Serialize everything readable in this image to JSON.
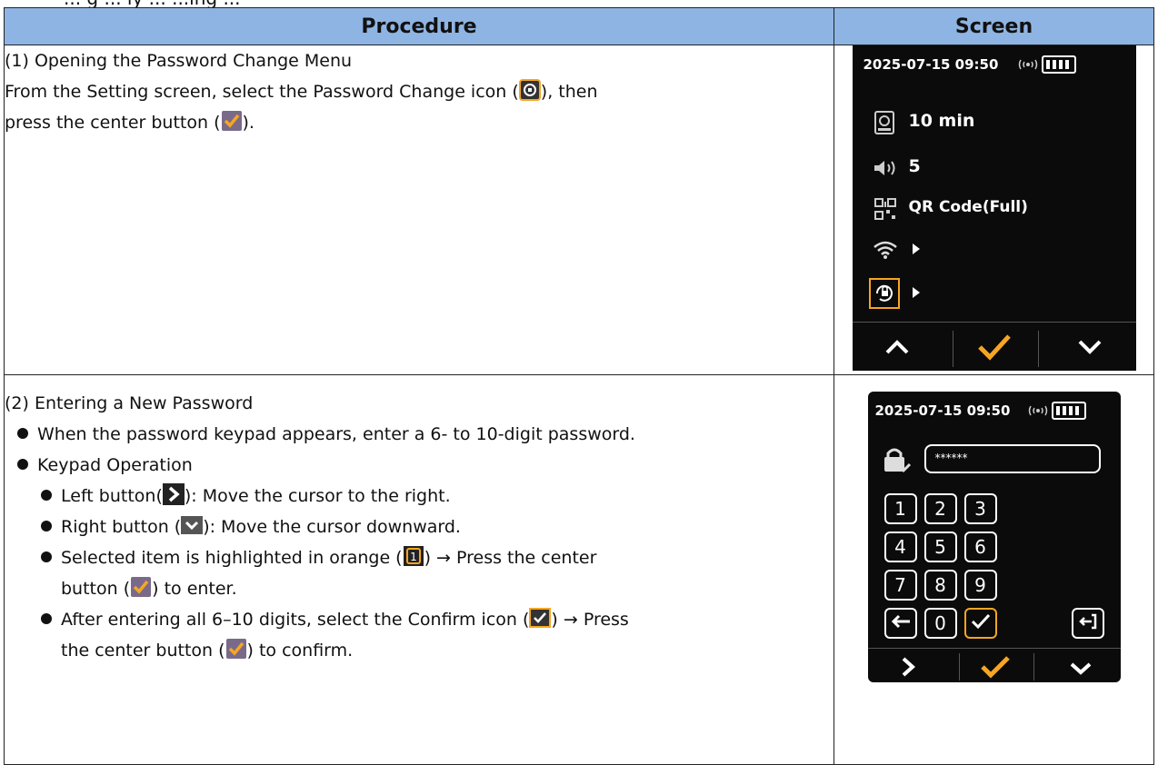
{
  "top_fragment": "... g ... ly ... ...ing ...",
  "headers": {
    "procedure": "Procedure",
    "screen": "Screen"
  },
  "step1": {
    "title": "(1) Opening the Password Change Menu",
    "line1a": "From the Setting screen, select the Password Change icon (",
    "line1b": "), then",
    "line2a": "press the center button (",
    "line2b": ")."
  },
  "step2": {
    "title": "(2) Entering a New Password",
    "b1": "When the password keypad appears, enter a 6- to 10-digit password.",
    "b2": "Keypad Operation",
    "b3a": "Left button(",
    "b3b": "): Move the cursor to the right.",
    "b4a": "Right button (",
    "b4b": "): Move the cursor downward.",
    "b5a": "Selected item is highlighted in orange (",
    "b5b": ") → Press the center",
    "b5c": "button (",
    "b5d": ") to enter.",
    "b6a": "After entering all 6–10 digits, select the Confirm icon (",
    "b6b": ") → Press",
    "b6c": "the center button (",
    "b6d": ") to confirm."
  },
  "screen1": {
    "datetime": "2025-07-15 09:50",
    "timeout": "10 min",
    "volume": "5",
    "qr_mode": "QR Code(Full)"
  },
  "screen2": {
    "datetime": "2025-07-15 09:50",
    "password_mask": "******",
    "keys": [
      "1",
      "2",
      "3",
      "4",
      "5",
      "6",
      "7",
      "8",
      "9",
      "0"
    ]
  },
  "colors": {
    "header_bg": "#8eb4e3",
    "accent_orange": "#f5a623",
    "screen_bg": "#0b0b0b"
  }
}
